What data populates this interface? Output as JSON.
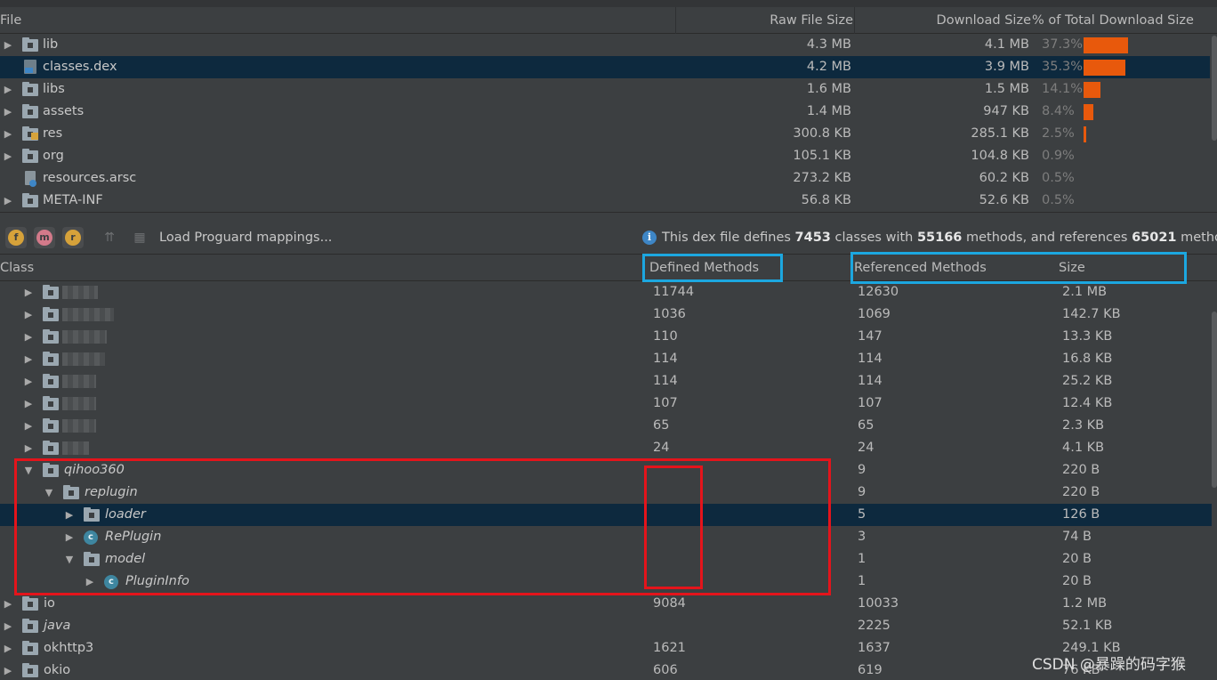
{
  "file_table": {
    "headers": {
      "file": "File",
      "raw": "Raw File Size",
      "download": "Download Size",
      "percent": "% of Total Download Size"
    },
    "rows": [
      {
        "name": "lib",
        "raw": "4.3 MB",
        "download": "4.1 MB",
        "percent": "37.3%",
        "share": 37.3,
        "expandable": true,
        "icon": "folder-icon"
      },
      {
        "name": "classes.dex",
        "raw": "4.2 MB",
        "download": "3.9 MB",
        "percent": "35.3%",
        "share": 35.3,
        "expandable": false,
        "icon": "dex-file-icon",
        "selected": true
      },
      {
        "name": "libs",
        "raw": "1.6 MB",
        "download": "1.5 MB",
        "percent": "14.1%",
        "share": 14.1,
        "expandable": true,
        "icon": "folder-icon"
      },
      {
        "name": "assets",
        "raw": "1.4 MB",
        "download": "947 KB",
        "percent": "8.4%",
        "share": 8.4,
        "expandable": true,
        "icon": "folder-icon"
      },
      {
        "name": "res",
        "raw": "300.8 KB",
        "download": "285.1 KB",
        "percent": "2.5%",
        "share": 2.5,
        "expandable": true,
        "icon": "res-folder-icon"
      },
      {
        "name": "org",
        "raw": "105.1 KB",
        "download": "104.8 KB",
        "percent": "0.9%",
        "share": 0.9,
        "expandable": true,
        "icon": "folder-icon"
      },
      {
        "name": "resources.arsc",
        "raw": "273.2 KB",
        "download": "60.2 KB",
        "percent": "0.5%",
        "share": 0.5,
        "expandable": false,
        "icon": "arsc-file-icon"
      },
      {
        "name": "META-INF",
        "raw": "56.8 KB",
        "download": "52.6 KB",
        "percent": "0.5%",
        "share": 0.5,
        "expandable": true,
        "icon": "folder-icon"
      }
    ]
  },
  "toolbar": {
    "buttons": [
      {
        "letter": "f",
        "color": "#d6a23a",
        "name": "show-fields-button"
      },
      {
        "letter": "m",
        "color": "#d37a8a",
        "name": "show-methods-button"
      },
      {
        "letter": "r",
        "color": "#d6a23a",
        "name": "show-referenced-button"
      }
    ],
    "load_label": "Load Proguard mappings...",
    "info": {
      "prefix": "This dex file defines ",
      "classes": "7453",
      "mid1": " classes with ",
      "methods": "55166",
      "mid2": " methods, and references ",
      "refs": "65021",
      "suffix": " methods"
    }
  },
  "class_table": {
    "headers": {
      "class": "Class",
      "defined": "Defined Methods",
      "referenced": "Referenced Methods",
      "size": "Size"
    },
    "rows": [
      {
        "level": 1,
        "name": "",
        "redacted": true,
        "defined": "11744",
        "referenced": "12630",
        "size": "2.1 MB",
        "arrow": "right",
        "icon": "package-icon"
      },
      {
        "level": 1,
        "name": "",
        "redacted": true,
        "defined": "1036",
        "referenced": "1069",
        "size": "142.7 KB",
        "arrow": "right",
        "icon": "package-icon"
      },
      {
        "level": 1,
        "name": "",
        "redacted": true,
        "defined": "110",
        "referenced": "147",
        "size": "13.3 KB",
        "arrow": "right",
        "icon": "package-icon"
      },
      {
        "level": 1,
        "name": "",
        "redacted": true,
        "defined": "114",
        "referenced": "114",
        "size": "16.8 KB",
        "arrow": "right",
        "icon": "package-icon"
      },
      {
        "level": 1,
        "name": "",
        "redacted": true,
        "defined": "114",
        "referenced": "114",
        "size": "25.2 KB",
        "arrow": "right",
        "icon": "package-icon"
      },
      {
        "level": 1,
        "name": "",
        "redacted": true,
        "defined": "107",
        "referenced": "107",
        "size": "12.4 KB",
        "arrow": "right",
        "icon": "package-icon"
      },
      {
        "level": 1,
        "name": "",
        "redacted": true,
        "defined": "65",
        "referenced": "65",
        "size": "2.3 KB",
        "arrow": "right",
        "icon": "package-icon"
      },
      {
        "level": 1,
        "name": "",
        "redacted": true,
        "defined": "24",
        "referenced": "24",
        "size": "4.1 KB",
        "arrow": "right",
        "icon": "package-icon"
      },
      {
        "level": 1,
        "name": "qihoo360",
        "italic": true,
        "defined": "",
        "referenced": "9",
        "size": "220 B",
        "arrow": "down",
        "icon": "package-icon"
      },
      {
        "level": 2,
        "name": "replugin",
        "italic": true,
        "defined": "",
        "referenced": "9",
        "size": "220 B",
        "arrow": "down",
        "icon": "package-icon"
      },
      {
        "level": 3,
        "name": "loader",
        "italic": true,
        "defined": "",
        "referenced": "5",
        "size": "126 B",
        "arrow": "right",
        "icon": "package-icon",
        "selected": true
      },
      {
        "level": 3,
        "name": "RePlugin",
        "italic": true,
        "defined": "",
        "referenced": "3",
        "size": "74 B",
        "arrow": "right",
        "icon": "class-icon"
      },
      {
        "level": 3,
        "name": "model",
        "italic": true,
        "defined": "",
        "referenced": "1",
        "size": "20 B",
        "arrow": "down",
        "icon": "package-icon"
      },
      {
        "level": 4,
        "name": "PluginInfo",
        "italic": true,
        "defined": "",
        "referenced": "1",
        "size": "20 B",
        "arrow": "right",
        "icon": "class-icon"
      },
      {
        "level": 0,
        "name": "io",
        "defined": "9084",
        "referenced": "10033",
        "size": "1.2 MB",
        "arrow": "right",
        "icon": "package-icon"
      },
      {
        "level": 0,
        "name": "java",
        "italic": true,
        "defined": "",
        "referenced": "2225",
        "size": "52.1 KB",
        "arrow": "right",
        "icon": "package-icon"
      },
      {
        "level": 0,
        "name": "okhttp3",
        "defined": "1621",
        "referenced": "1637",
        "size": "249.1 KB",
        "arrow": "right",
        "icon": "package-icon"
      },
      {
        "level": 0,
        "name": "okio",
        "defined": "606",
        "referenced": "619",
        "size": "76 KB",
        "arrow": "right",
        "icon": "package-icon"
      }
    ]
  },
  "colors": {
    "bar": "#e8590c",
    "selection": "#0d293e",
    "blue_annotation": "#1ca7e0",
    "red_annotation": "#e4141b"
  },
  "watermark": "CSDN @暴躁的码字猴"
}
